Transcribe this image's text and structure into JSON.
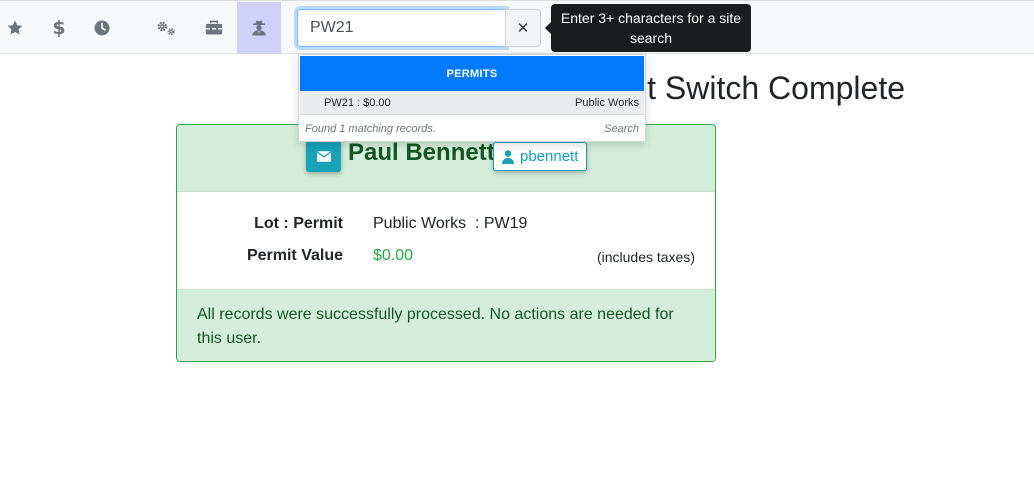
{
  "nav": {
    "items": [
      {
        "name": "favorites",
        "icon": "star-icon"
      },
      {
        "name": "billing",
        "icon": "dollar-icon",
        "glyph": "$"
      },
      {
        "name": "history",
        "icon": "clock-icon"
      },
      {
        "name": "settings",
        "icon": "gears-icon"
      },
      {
        "name": "toolbox",
        "icon": "toolbox-icon"
      },
      {
        "name": "admin",
        "icon": "user-secret-icon",
        "active": true
      }
    ]
  },
  "search": {
    "value": "PW21",
    "clear_glyph": "✕",
    "tooltip": "Enter 3+ characters for a site search"
  },
  "dropdown": {
    "header": "PERMITS",
    "results": [
      {
        "left": "PW21 : $0.00",
        "right": "Public Works"
      }
    ],
    "footer_found": "Found 1 matching records.",
    "footer_search": "Search"
  },
  "page": {
    "title": "Permit Switch Complete"
  },
  "card": {
    "user_name": "Paul Bennett",
    "username": "pbennett",
    "rows": [
      {
        "label": "Lot : Permit",
        "value": "Public Works  : PW19"
      },
      {
        "label": "Permit Value",
        "value": "$0.00",
        "note": "(includes taxes)"
      }
    ],
    "footer": "All records were successfully processed. No actions are needed for this user."
  },
  "colors": {
    "primary": "#007bff",
    "success": "#28a745",
    "success_bg": "#d4edda",
    "info": "#17a2b8",
    "active_nav": "#d1d0fb"
  }
}
